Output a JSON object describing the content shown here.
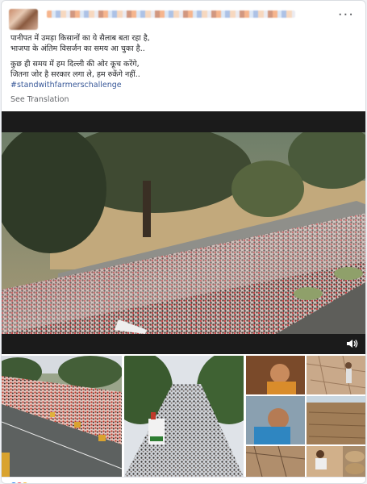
{
  "post": {
    "author_name": "",
    "lines": [
      "पानीपत में उमड़ा किसानों का ये सैलाब बता रहा है,",
      "भाजपा के अंतिम विसर्जन का समय आ चुका है..",
      "कुछ ही समय में हम दिल्ली की ओर कूच करेंगे,",
      "जितना जोर है सरकार लगा ले, हम रुकेंगे नहीं.."
    ],
    "hashtag": "#standwithfarmerschallenge",
    "see_translation": "See Translation",
    "more_icon": "···"
  },
  "colors": {
    "link": "#385898",
    "secondary_text": "#65676b",
    "like_blue": "#1877f2",
    "love_red": "#f33e58"
  },
  "icons": {
    "more": "more-options-icon",
    "volume": "volume-icon"
  }
}
